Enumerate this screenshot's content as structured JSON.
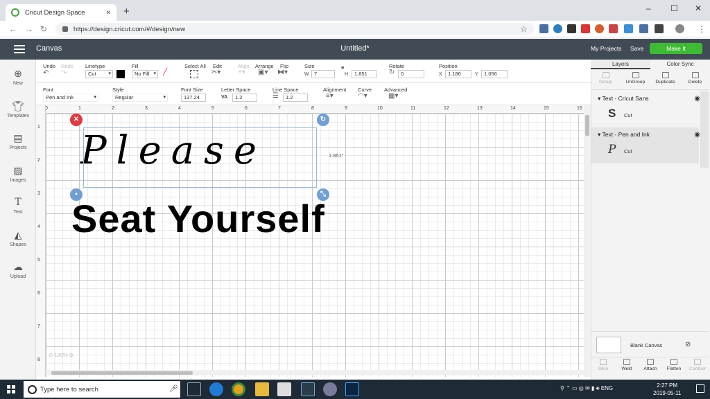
{
  "browser": {
    "tab_title": "Cricut Design Space",
    "new_tab": "+",
    "url": "https://design.cricut.com/#/design/new",
    "minimize": "–",
    "maximize": "☐",
    "close": "✕"
  },
  "app": {
    "section": "Canvas",
    "doc_title": "Untitled*",
    "my_projects": "My Projects",
    "save": "Save",
    "make_it": "Make It"
  },
  "toolbar1": {
    "undo": "Undo",
    "redo": "Redo",
    "linetype": "Linetype",
    "linetype_value": "Cut",
    "fill": "Fill",
    "fill_value": "No Fill",
    "select_all": "Select All",
    "edit": "Edit",
    "align": "Align",
    "arrange": "Arrange",
    "flip": "Flip",
    "size": "Size",
    "w_label": "W",
    "w_value": "7",
    "h_label": "H",
    "h_value": "1.851",
    "rotate": "Rotate",
    "rotate_value": "0",
    "position": "Position",
    "x_label": "X",
    "x_value": "1.186",
    "y_label": "Y",
    "y_value": "1.056"
  },
  "toolbar2": {
    "font": "Font",
    "font_value": "Pen and Ink",
    "style": "Style",
    "style_value": "Regular",
    "font_size": "Font Size",
    "font_size_value": "137.24",
    "letter_space": "Letter Space",
    "letter_space_value": "1.2",
    "line_space": "Line Space",
    "line_space_value": "1.2",
    "alignment": "Alignment",
    "curve": "Curve",
    "advanced": "Advanced"
  },
  "sidebar": {
    "items": [
      {
        "label": "New"
      },
      {
        "label": "Templates"
      },
      {
        "label": "Projects"
      },
      {
        "label": "Images"
      },
      {
        "label": "Text"
      },
      {
        "label": "Shapes"
      },
      {
        "label": "Upload"
      }
    ]
  },
  "ruler": {
    "top": [
      "0",
      "1",
      "2",
      "3",
      "4",
      "5",
      "6",
      "7",
      "8",
      "9",
      "10",
      "11",
      "12",
      "13",
      "14",
      "15",
      "16"
    ],
    "left": [
      "1",
      "2",
      "3",
      "4",
      "5",
      "6",
      "7",
      "8"
    ]
  },
  "canvas": {
    "line1": "Please",
    "line2": "Seat Yourself",
    "dimension": "1.851\"",
    "zoom": "100%"
  },
  "panel": {
    "tabs": [
      "Layers",
      "Color Sync"
    ],
    "actions": [
      "Group",
      "UnGroup",
      "Duplicate",
      "Delete"
    ],
    "layers": [
      {
        "name": "Text - Cricut Sans",
        "glyph": "S",
        "op": "Cut"
      },
      {
        "name": "Text - Pen and Ink",
        "glyph": "P",
        "op": "Cut"
      }
    ],
    "blank_canvas": "Blank Canvas",
    "bottom": [
      "Slice",
      "Weld",
      "Attach",
      "Flatten",
      "Contour"
    ]
  },
  "taskbar": {
    "search": "Type here to search",
    "lang": "ENG",
    "time": "2:27 PM",
    "date": "2019-05-11"
  }
}
